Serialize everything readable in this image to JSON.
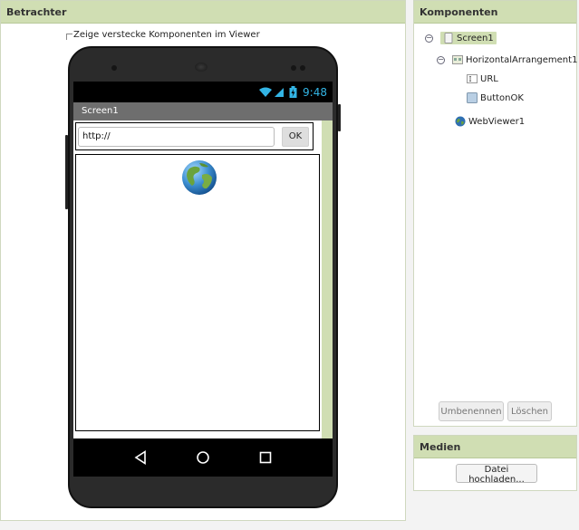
{
  "viewer": {
    "title": "Betrachter",
    "hidden_components_label": "Zeige verstecke Komponenten im Viewer",
    "phone": {
      "status_time": "9:48",
      "screen_title": "Screen1",
      "url_field_value": "http://",
      "ok_button_label": "OK"
    }
  },
  "components": {
    "title": "Komponenten",
    "tree": {
      "screen": "Screen1",
      "arrangement": "HorizontalArrangement1",
      "textbox": "URL",
      "button": "ButtonOK",
      "webviewer": "WebViewer1"
    },
    "rename_label": "Umbenennen",
    "delete_label": "Löschen"
  },
  "media": {
    "title": "Medien",
    "upload_label": "Datei hochladen..."
  },
  "colors": {
    "header_green": "#d0deb3",
    "status_blue": "#33b5e5"
  }
}
